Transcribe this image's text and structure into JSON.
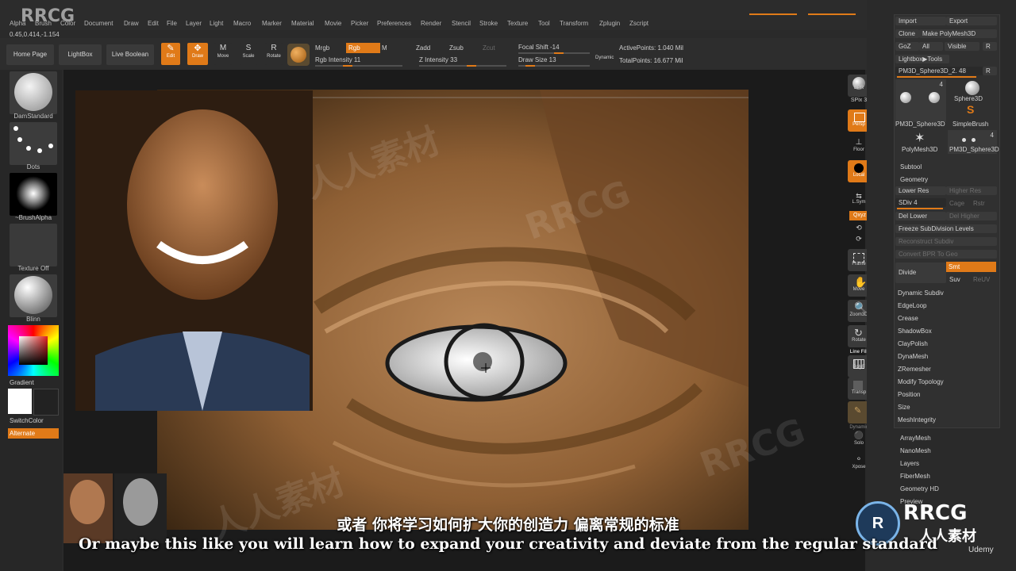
{
  "watermark": {
    "brand": "RRCG",
    "brand_cn": "人人素材"
  },
  "menu": [
    "Alpha",
    "Brush",
    "Color",
    "Document",
    "Draw",
    "Edit",
    "File",
    "Layer",
    "Light",
    "Macro",
    "Marker",
    "Material",
    "Movie",
    "Picker",
    "Preferences",
    "Render",
    "Stencil",
    "Stroke",
    "Texture",
    "Tool",
    "Transform",
    "Zplugin",
    "Zscript"
  ],
  "coords": "0.45,0.414,-1.154",
  "toolbar": {
    "home_page": "Home Page",
    "lightbox": "LightBox",
    "live_boolean": "Live Boolean",
    "edit": "Edit",
    "draw": "Draw",
    "move": "Move",
    "scale": "Scale",
    "rotate": "Rotate",
    "mrgb": "Mrgb",
    "rgb": "Rgb",
    "m": "M",
    "rgb_intensity": "Rgb Intensity 11",
    "zadd": "Zadd",
    "zsub": "Zsub",
    "zcut": "Zcut",
    "z_intensity": "Z Intensity 33",
    "focal_shift": "Focal Shift -14",
    "draw_size": "Draw Size 13",
    "dynamic": "Dynamic",
    "active_points": "ActivePoints: 1.040 Mil",
    "total_points": "TotalPoints: 16.677 Mil"
  },
  "leftshelf": {
    "brush": "DamStandard",
    "stroke": "Dots",
    "alpha": "~BrushAlpha",
    "texture": "Texture Off",
    "material": "Blinn",
    "gradient": "Gradient",
    "switch_color": "SwitchColor",
    "alternate": "Alternate"
  },
  "viewcontrols": {
    "bpr": "BPR",
    "spix": "SPix 3",
    "persp": "Persp",
    "floor": "Floor",
    "local": "Local",
    "lsym": "L.Sym",
    "xyz": "Qxyz",
    "frame": "Frame",
    "move": "Move",
    "zoom3d": "Zoom3D",
    "rotate": "Rotate",
    "line_fill": "Line Fill",
    "polyf": "PolyF",
    "transp": "Transp",
    "dynamic": "Dynamic",
    "solo": "Solo",
    "xpose": "Xpose"
  },
  "tool": {
    "import": "Import",
    "export": "Export",
    "clone": "Clone",
    "make_polymesh": "Make PolyMesh3D",
    "goz": "GoZ",
    "all": "All",
    "visible": "Visible",
    "r": "R",
    "lightbox_tools": "Lightbox▶Tools",
    "current_tool": "PM3D_Sphere3D_2. 48",
    "count_a": "4",
    "count_b": "4",
    "sphere3d": "Sphere3D",
    "pm3d_sphere": "PM3D_Sphere3D",
    "simplebrush": "SimpleBrush",
    "polymesh3d": "PolyMesh3D",
    "pm3d_sphere_b": "PM3D_Sphere3D",
    "subtool": "Subtool",
    "geometry": "Geometry",
    "lower_res": "Lower Res",
    "higher_res": "Higher Res",
    "sdiv": "SDiv 4",
    "cage": "Cage",
    "rstr": "Rstr",
    "del_lower": "Del Lower",
    "del_higher": "Del Higher",
    "freeze": "Freeze SubDivision Levels",
    "reconstruct": "Reconstruct Subdiv",
    "convert_bpr": "Convert BPR To Geo",
    "divide": "Divide",
    "smt": "Smt",
    "suv": "Suv",
    "reuv": "ReUV",
    "items": [
      "Dynamic Subdiv",
      "EdgeLoop",
      "Crease",
      "ShadowBox",
      "ClayPolish",
      "DynaMesh",
      "ZRemesher",
      "Modify Topology",
      "Position",
      "Size",
      "MeshIntegrity"
    ],
    "more": [
      "ArrayMesh",
      "NanoMesh",
      "Layers",
      "FiberMesh",
      "Geometry HD",
      "Preview"
    ]
  },
  "subtitles": {
    "cn": "或者 你将学习如何扩大你的创造力 偏离常规的标准",
    "en": "Or maybe this like you will learn how to expand your creativity and deviate from the regular standard"
  },
  "corner_logo": {
    "brand": "RRCG",
    "brand_cn": "人人素材",
    "udemy": "Udemy"
  }
}
